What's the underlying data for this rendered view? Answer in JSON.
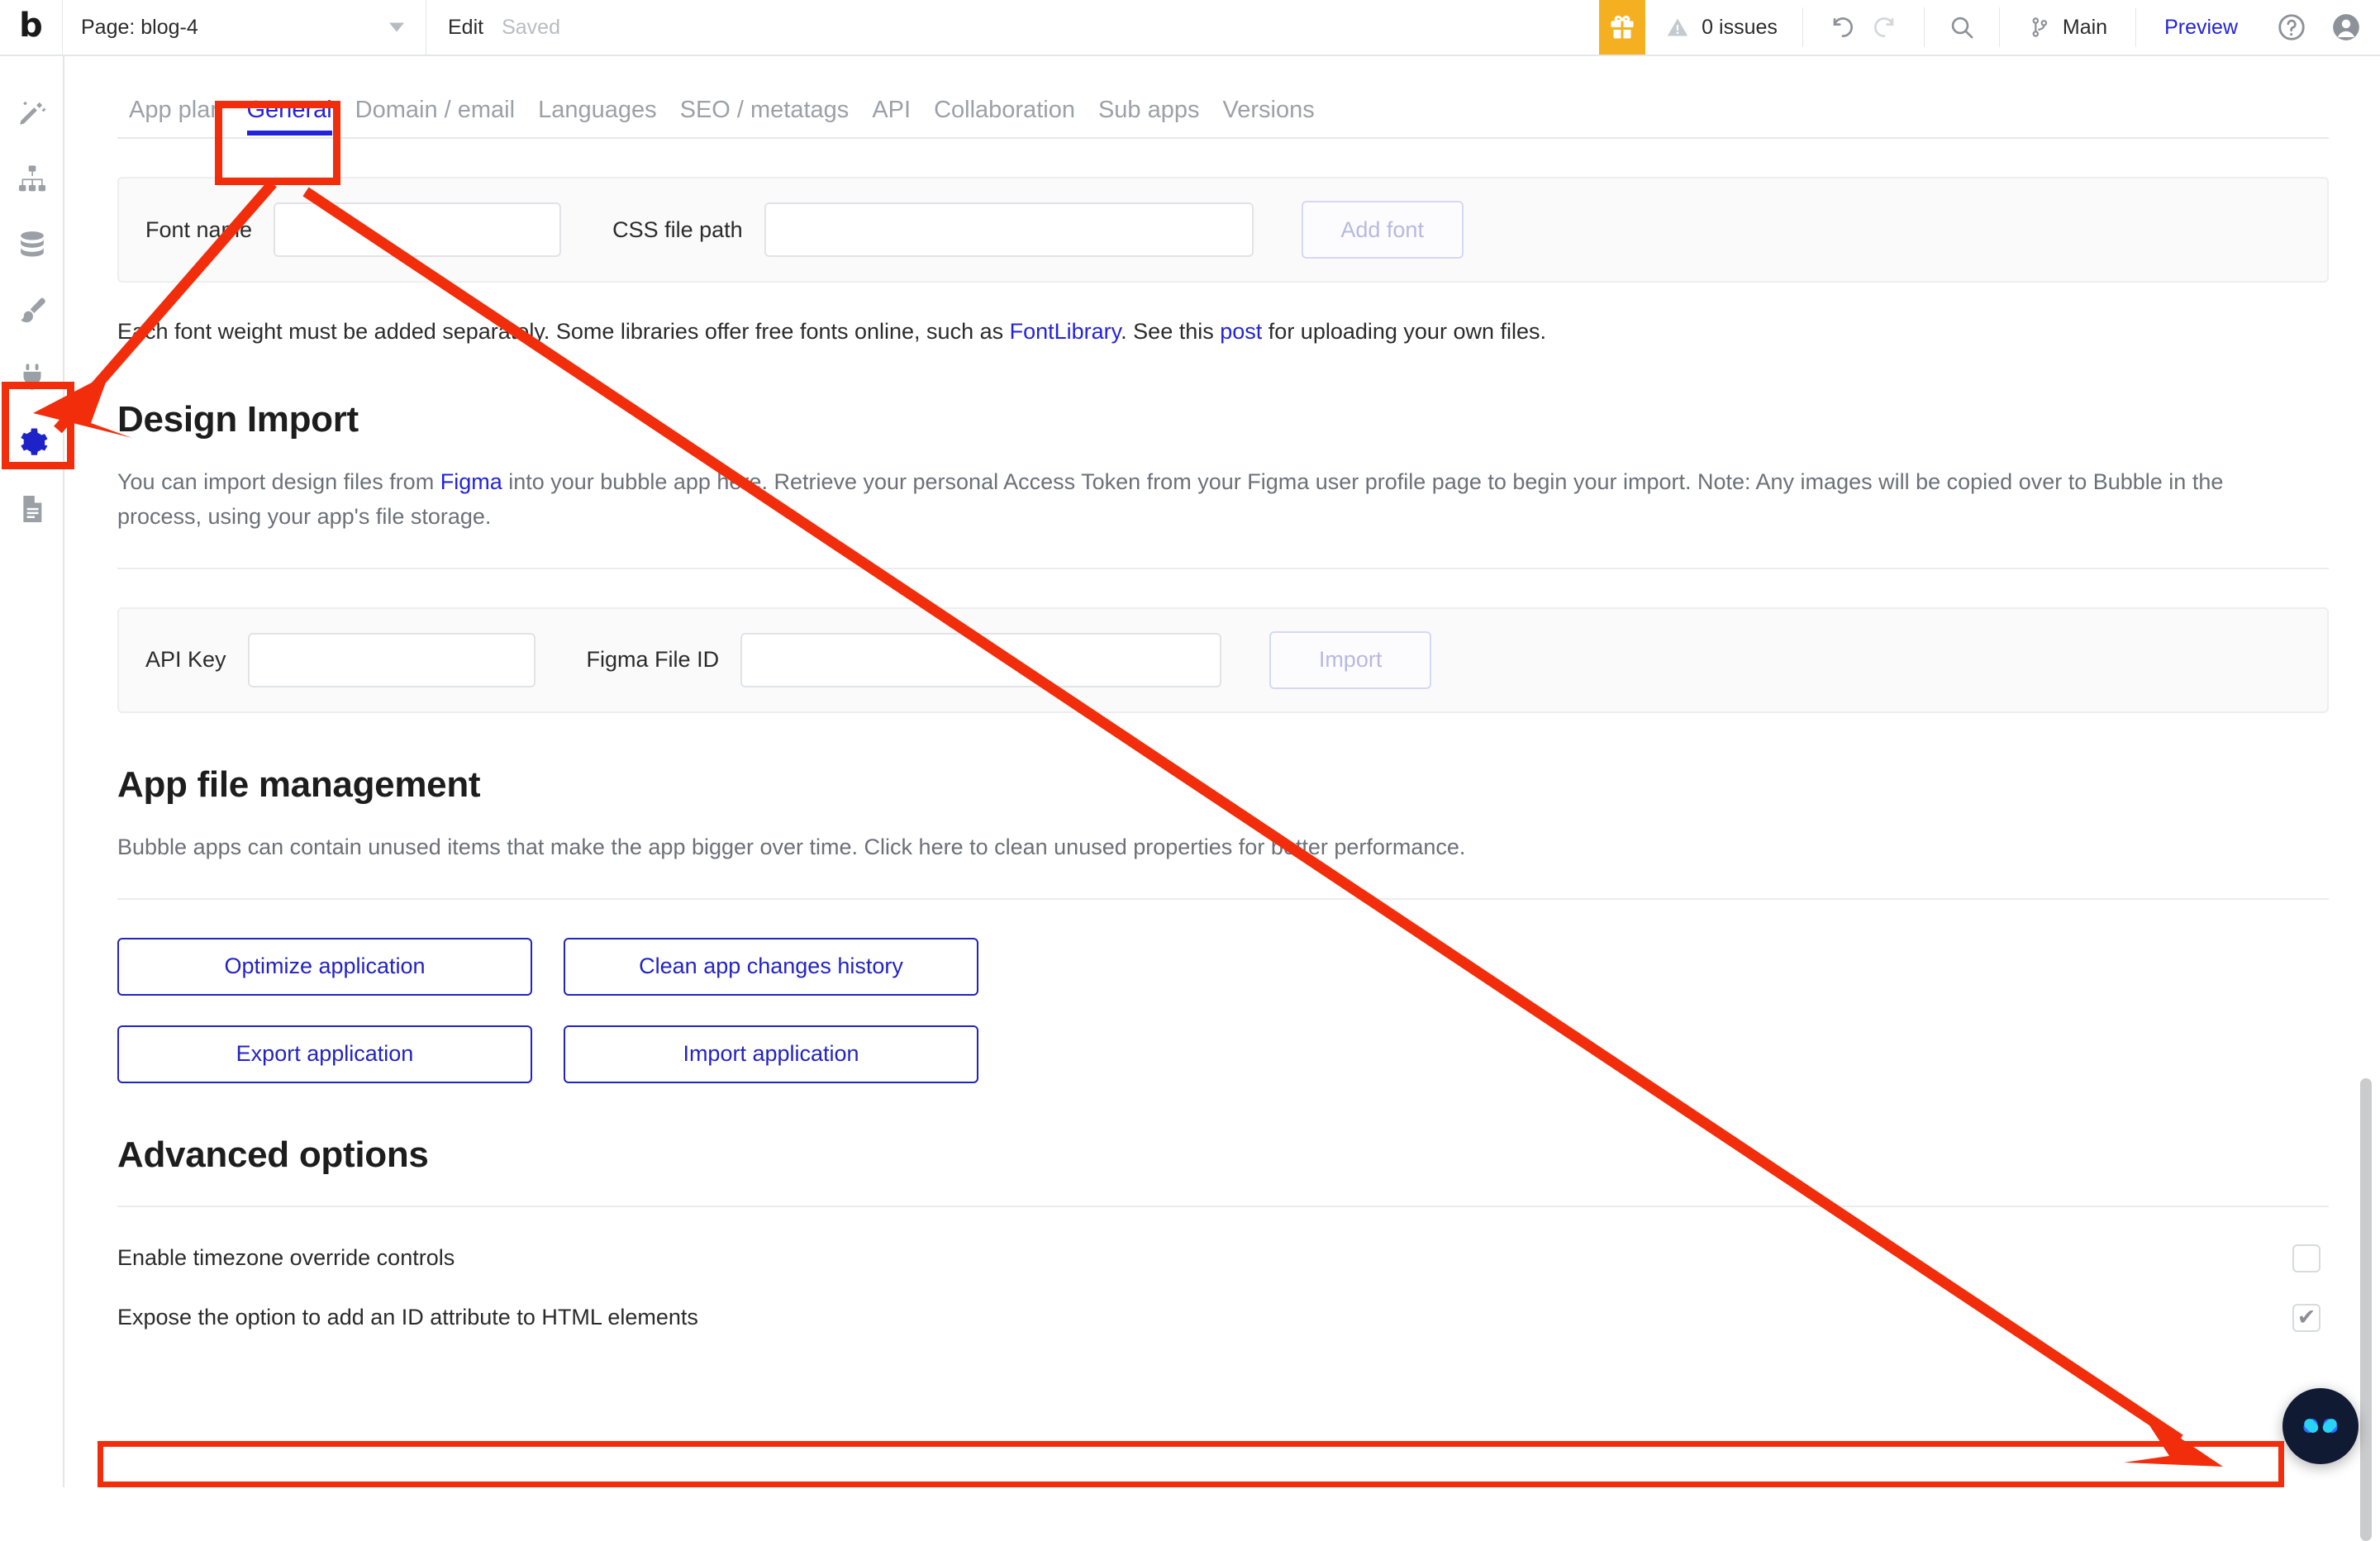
{
  "topbar": {
    "logo": "bubble-logo",
    "page_label": "Page: blog-4",
    "edit_label": "Edit",
    "saved_label": "Saved",
    "gift_icon": "gift-icon",
    "issues_icon": "warning-icon",
    "issues_text": "0 issues",
    "undo_icon": "undo-icon",
    "redo_icon": "redo-icon",
    "search_icon": "search-icon",
    "branch_icon": "branch-icon",
    "branch_text": "Main",
    "preview_text": "Preview",
    "help_icon": "help-circle-icon",
    "user_icon": "user-avatar-icon",
    "accent_blue": "#2323dd",
    "gift_bg": "#f5b021"
  },
  "sidebar": {
    "items": [
      {
        "icon": "design-wand-icon",
        "name": "design",
        "active": false
      },
      {
        "icon": "workflow-tree-icon",
        "name": "workflow",
        "active": false
      },
      {
        "icon": "database-icon",
        "name": "data",
        "active": false
      },
      {
        "icon": "paintbrush-icon",
        "name": "styles",
        "active": false
      },
      {
        "icon": "plug-icon",
        "name": "plugins",
        "active": false
      },
      {
        "icon": "gear-icon",
        "name": "settings",
        "active": true
      },
      {
        "icon": "document-logs-icon",
        "name": "logs",
        "active": false
      }
    ]
  },
  "tabs": [
    {
      "label": "App plan",
      "active": false
    },
    {
      "label": "General",
      "active": true
    },
    {
      "label": "Domain / email",
      "active": false
    },
    {
      "label": "Languages",
      "active": false
    },
    {
      "label": "SEO / metatags",
      "active": false
    },
    {
      "label": "API",
      "active": false
    },
    {
      "label": "Collaboration",
      "active": false
    },
    {
      "label": "Sub apps",
      "active": false
    },
    {
      "label": "Versions",
      "active": false
    }
  ],
  "font_panel": {
    "font_name_label": "Font name",
    "font_name_value": "",
    "css_path_label": "CSS file path",
    "css_path_value": "",
    "add_font_label": "Add font"
  },
  "font_note": {
    "part1": "Each font weight must be added separately. Some libraries offer free fonts online, such as ",
    "link1": "FontLibrary",
    "part2": ". See this ",
    "link2": "post",
    "part3": " for uploading your own files."
  },
  "design_import": {
    "heading": "Design Import",
    "desc_part1": "You can import design files from ",
    "desc_link": "Figma",
    "desc_part2": " into your bubble app here. Retrieve your personal Access Token from your Figma user profile page to begin your import. Note: Any images will be copied over to Bubble in the process, using your app's file storage.",
    "api_key_label": "API Key",
    "api_key_value": "",
    "figma_file_id_label": "Figma File ID",
    "figma_file_id_value": "",
    "import_label": "Import"
  },
  "app_file_management": {
    "heading": "App file management",
    "desc": "Bubble apps can contain unused items that make the app bigger over time. Click here to clean unused properties for better performance.",
    "buttons": [
      "Optimize application",
      "Clean app changes history",
      "Export application",
      "Import application"
    ]
  },
  "advanced_options": {
    "heading": "Advanced options",
    "options": [
      {
        "label": "Enable timezone override controls",
        "checked": false,
        "tick": ""
      },
      {
        "label": "Expose the option to add an ID attribute to HTML elements",
        "checked": true,
        "tick": "✔"
      }
    ]
  },
  "fab": {
    "icon": "code-bubble-icon"
  },
  "annotations": {
    "color": "#f22d0c",
    "box_gear": "highlight-settings-gear",
    "box_general": "highlight-general-tab",
    "box_bottom": "highlight-expose-id-row",
    "arrow_to_gear": "arrow-pointing-to-settings-gear",
    "arrow_to_checkbox": "arrow-pointing-to-expose-id-checkbox"
  },
  "scrollbar": {
    "name": "vertical-scrollbar"
  }
}
